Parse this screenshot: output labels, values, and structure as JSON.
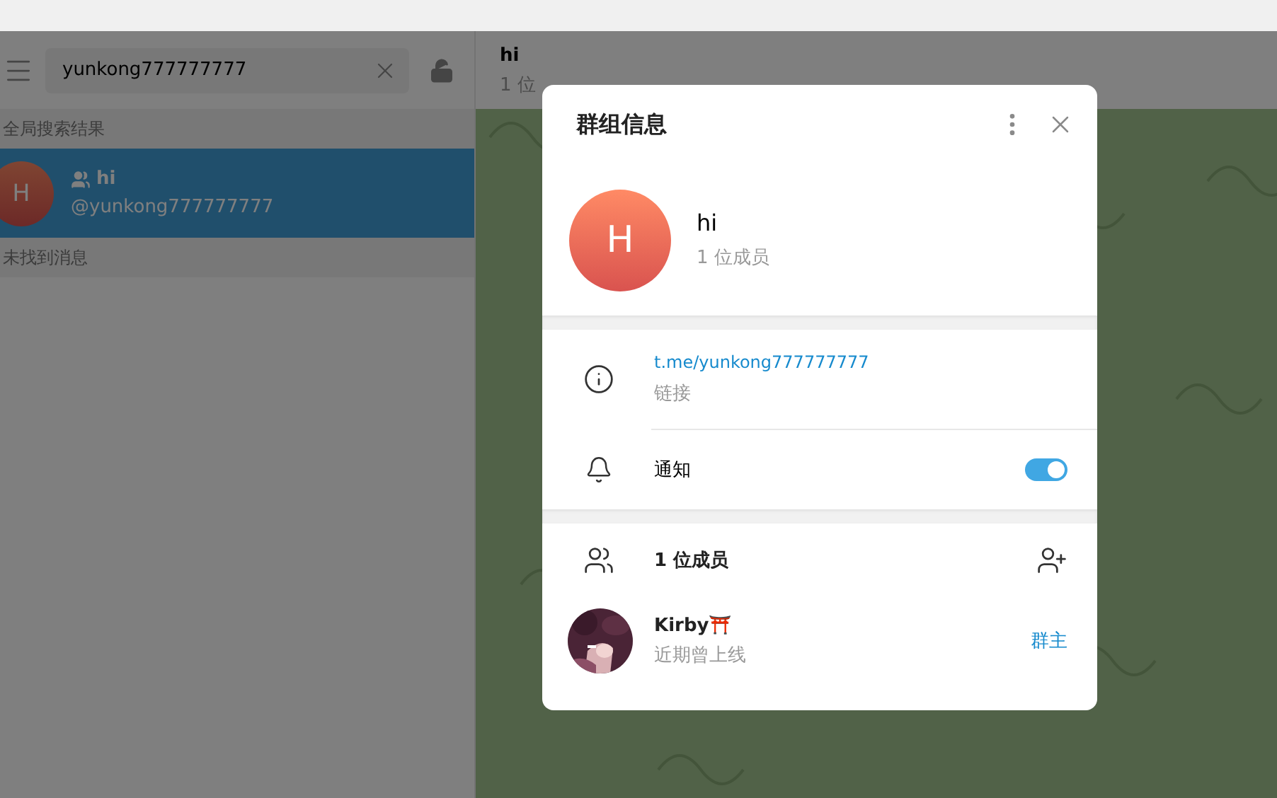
{
  "sidebar": {
    "search": {
      "value": "yunkong777777777"
    },
    "sections": [
      {
        "title": "全局搜索结果",
        "results": [
          {
            "name": "hi",
            "username": "@yunkong777777777",
            "avatar_letter": "H",
            "selected": true
          }
        ]
      },
      {
        "title": "未找到消息"
      }
    ]
  },
  "chat_header": {
    "title": "hi",
    "subtitle": "1 位"
  },
  "dialog": {
    "title": "群组信息",
    "group": {
      "avatar_letter": "H",
      "name": "hi",
      "members": "1 位成员"
    },
    "link": {
      "value": "t.me/yunkong777777777",
      "label": "链接"
    },
    "notifications": {
      "label": "通知",
      "on": true
    },
    "members_header": "1 位成员",
    "members": [
      {
        "name": "Kirby⛩️",
        "status": "近期曾上线",
        "role": "群主"
      }
    ]
  }
}
